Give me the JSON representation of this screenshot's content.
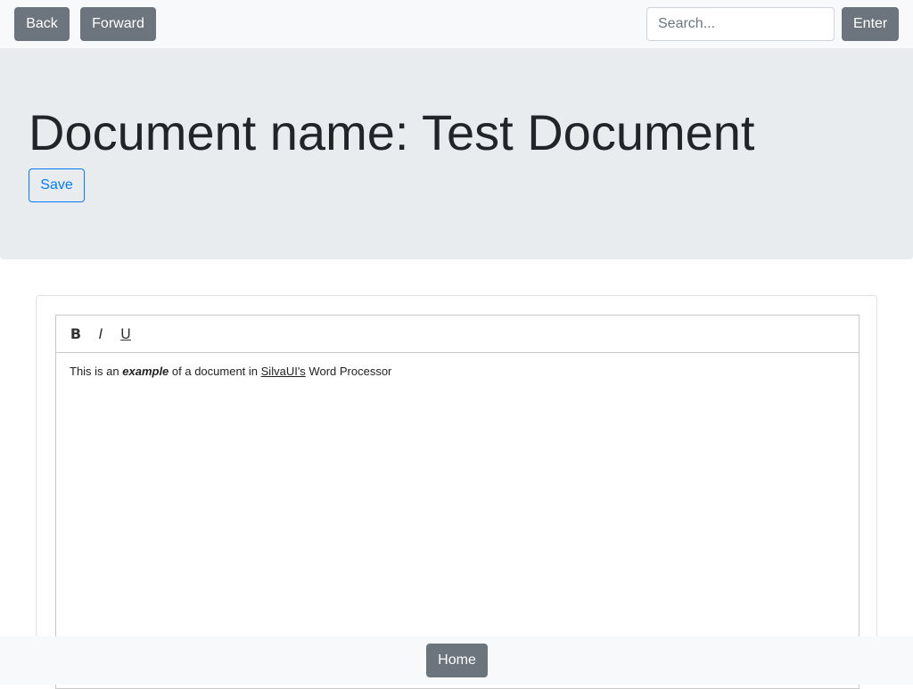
{
  "nav": {
    "back_label": "Back",
    "forward_label": "Forward",
    "search_placeholder": "Search...",
    "search_value": "",
    "enter_label": "Enter"
  },
  "header": {
    "title": "Document name: Test Document",
    "save_label": "Save"
  },
  "editor": {
    "toolbar": {
      "bold": "B",
      "italic": "I",
      "underline": "U"
    },
    "content": {
      "part1": "This is an ",
      "bold_italic": "example",
      "part2": " of a document in ",
      "underlined": "SilvaUI's",
      "part3": " Word Processor"
    }
  },
  "footer": {
    "home_label": "Home"
  },
  "colors": {
    "secondary": "#6c757d",
    "primary": "#007bff",
    "jumbotron_bg": "#e9ecef",
    "nav_bg": "#f8f9fa"
  }
}
